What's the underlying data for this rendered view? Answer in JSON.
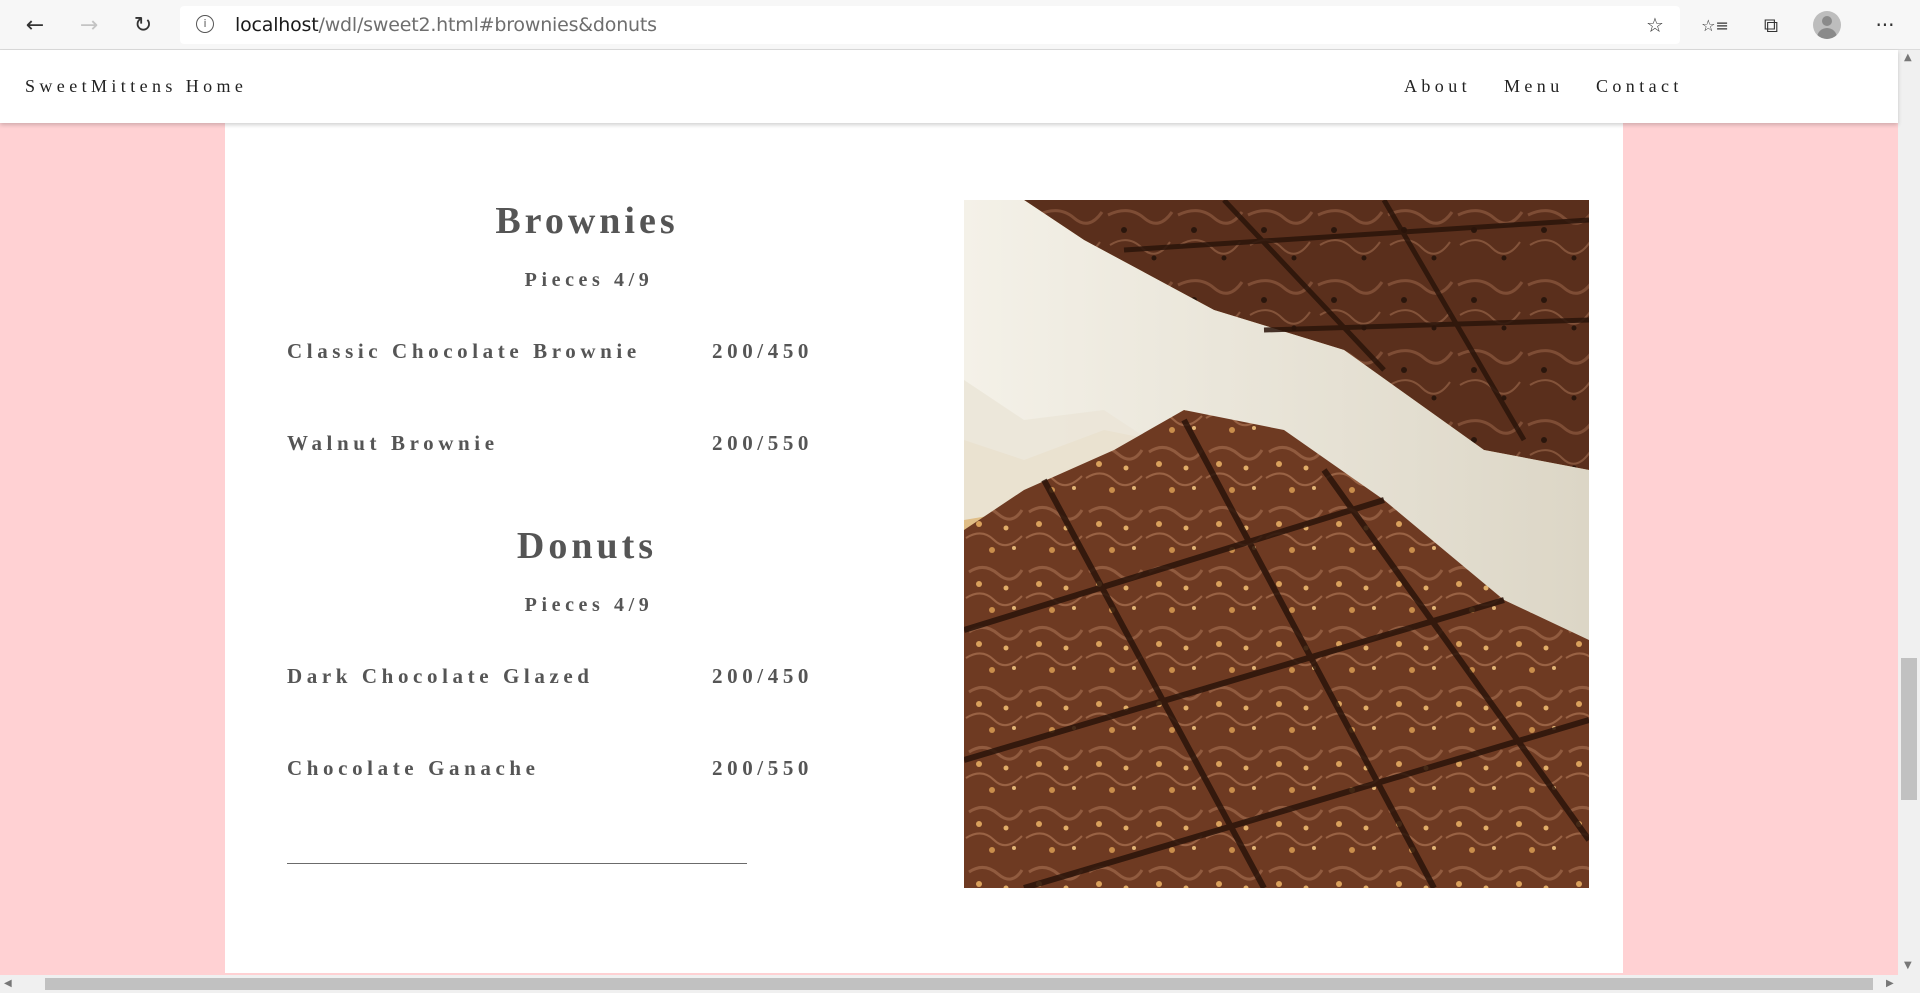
{
  "browser": {
    "url_host": "localhost",
    "url_path": "/wdl/sweet2.html#brownies&donuts",
    "back_icon": "←",
    "forward_icon": "→",
    "refresh_icon": "↻",
    "info_icon": "i",
    "star_icon": "☆",
    "favorites_icon": "☆≡",
    "collections_icon": "⧉",
    "more_icon": "···"
  },
  "header": {
    "brand": "SweetMittens Home",
    "nav": [
      "About",
      "Menu",
      "Contact"
    ]
  },
  "sections": [
    {
      "title": "Brownies",
      "subtitle": "Pieces 4/9",
      "items": [
        {
          "name": "Classic Chocolate Brownie",
          "price": "200/450"
        },
        {
          "name": "Walnut Brownie",
          "price": "200/550"
        }
      ]
    },
    {
      "title": "Donuts",
      "subtitle": "Pieces 4/9",
      "items": [
        {
          "name": "Dark Chocolate Glazed",
          "price": "200/450"
        },
        {
          "name": "Chocolate Ganache",
          "price": "200/550"
        }
      ]
    }
  ],
  "colors": {
    "page_background": "#ffd1d3",
    "card": "#ffffff",
    "text": "#555555"
  }
}
